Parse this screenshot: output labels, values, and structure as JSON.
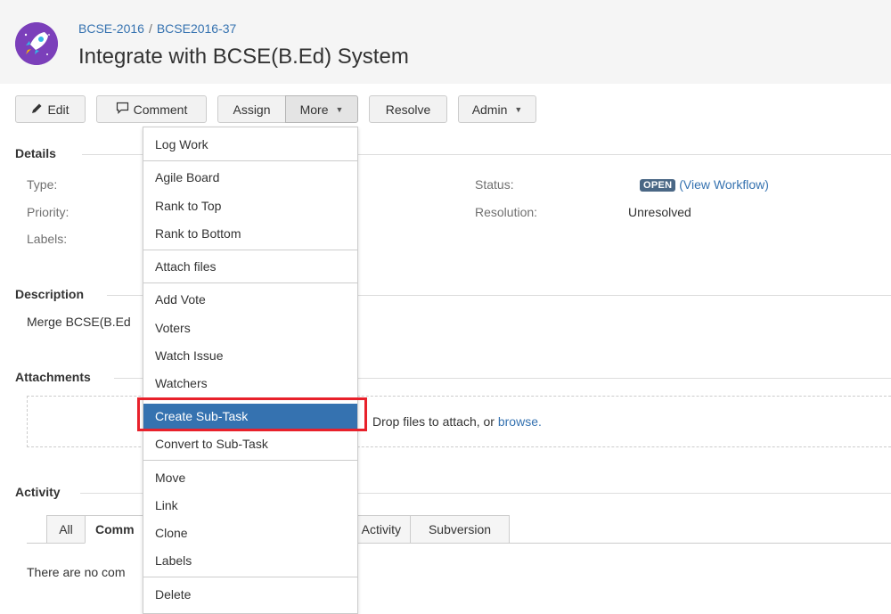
{
  "header": {
    "project_link": "BCSE-2016",
    "separator": "/",
    "issue_key": "BCSE2016-37",
    "title": "Integrate with BCSE(B.Ed) System"
  },
  "toolbar": {
    "edit": "Edit",
    "comment": "Comment",
    "assign": "Assign",
    "more": "More",
    "resolve": "Resolve",
    "admin": "Admin"
  },
  "details": {
    "heading": "Details",
    "type_label": "Type:",
    "priority_label": "Priority:",
    "labels_label": "Labels:",
    "status_label": "Status:",
    "status_value": "OPEN",
    "view_workflow": "(View Workflow)",
    "resolution_label": "Resolution:",
    "resolution_value": "Unresolved"
  },
  "description": {
    "heading": "Description",
    "text": "Merge BCSE(B.Ed"
  },
  "attachments": {
    "heading": "Attachments",
    "drop_text": "Drop files to attach, or",
    "browse": "browse."
  },
  "activity": {
    "heading": "Activity",
    "tabs": [
      "All",
      "Comm",
      "Activity",
      "Subversion"
    ],
    "empty_text": "There are no com"
  },
  "more_menu": {
    "items": [
      "Log Work",
      "Agile Board",
      "Rank to Top",
      "Rank to Bottom",
      "Attach files",
      "Add Vote",
      "Voters",
      "Watch Issue",
      "Watchers",
      "Create Sub-Task",
      "Convert to Sub-Task",
      "Move",
      "Link",
      "Clone",
      "Labels",
      "Delete"
    ],
    "active_item": "Create Sub-Task"
  },
  "colors": {
    "link": "#3572b0",
    "menu_highlight": "#3572b0",
    "status_lozenge": "#4a6785",
    "annotation_box": "#e8212b"
  }
}
